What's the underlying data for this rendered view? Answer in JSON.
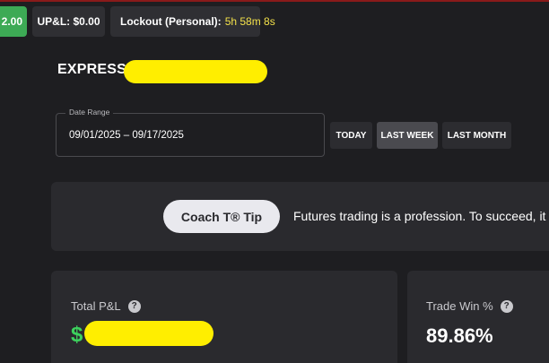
{
  "header": {
    "balance_chip": "2.00",
    "upnl_label": "UP&L: $0.00",
    "lockout_label": "Lockout (Personal):",
    "lockout_timer": "5h 58m 8s"
  },
  "account": {
    "title": "EXPRESS-"
  },
  "date_range": {
    "legend": "Date Range",
    "value": "09/01/2025 – 09/17/2025"
  },
  "range_buttons": {
    "today": "TODAY",
    "last_week": "LAST WEEK",
    "last_month": "LAST MONTH",
    "selected": "last_week"
  },
  "coach": {
    "button_label": "Coach T® Tip",
    "tip_text": "Futures trading is a profession. To succeed, it t"
  },
  "stats": {
    "total_pnl_label": "Total P&L",
    "total_pnl_value": "$",
    "trade_win_label": "Trade Win %",
    "trade_win_value": "89.86%",
    "help_glyph": "?"
  },
  "colors": {
    "accent_green": "#3dd15d",
    "timer_yellow": "#f2e04a",
    "redaction_yellow": "#ffee00",
    "top_border_red": "#8a1a1a"
  }
}
